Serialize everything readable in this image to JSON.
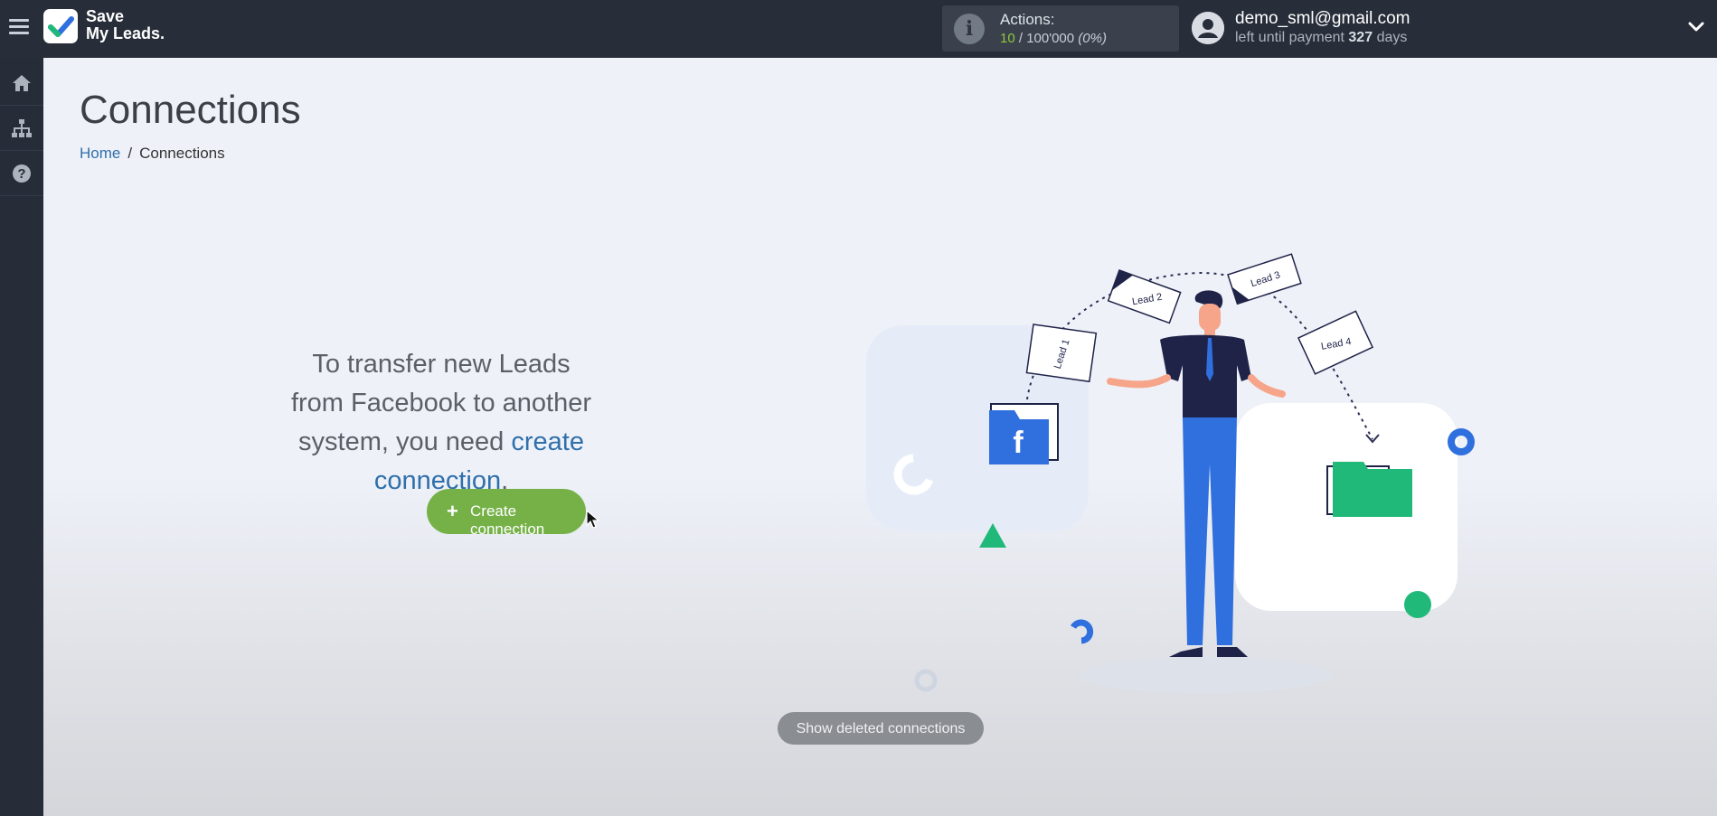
{
  "app": {
    "logo_line1": "Save",
    "logo_line2": "My Leads",
    "logo_dot": "."
  },
  "header": {
    "actions_label": "Actions:",
    "actions_used": "10",
    "actions_total": " / 100'000",
    "actions_pct": "(0%)",
    "user_email": "demo_sml@gmail.com",
    "payment_text": "left until payment",
    "payment_days": "327",
    "payment_days_unit": "days"
  },
  "sidebar": {
    "items": [
      {
        "name": "home-icon"
      },
      {
        "name": "sitemap-icon"
      },
      {
        "name": "help-icon"
      }
    ]
  },
  "main": {
    "title": "Connections",
    "breadcrumb": {
      "home": "Home",
      "separator": "/",
      "current": "Connections"
    },
    "message_before": "To transfer new Leads from Facebook to another system, you need",
    "message_link": "create connection",
    "message_after": ".",
    "create_button": "Create connection",
    "create_button_plus": "+",
    "show_deleted_button": "Show deleted connections"
  },
  "illustration": {
    "leads": [
      "Lead 1",
      "Lead 2",
      "Lead 3",
      "Lead 4"
    ],
    "facebook_letter": "f"
  },
  "colors": {
    "topbar": "#272d39",
    "accent_green": "#76b148",
    "link_blue": "#2f6fab",
    "facebook_blue": "#2f6fde",
    "folder_green": "#21b97a"
  }
}
